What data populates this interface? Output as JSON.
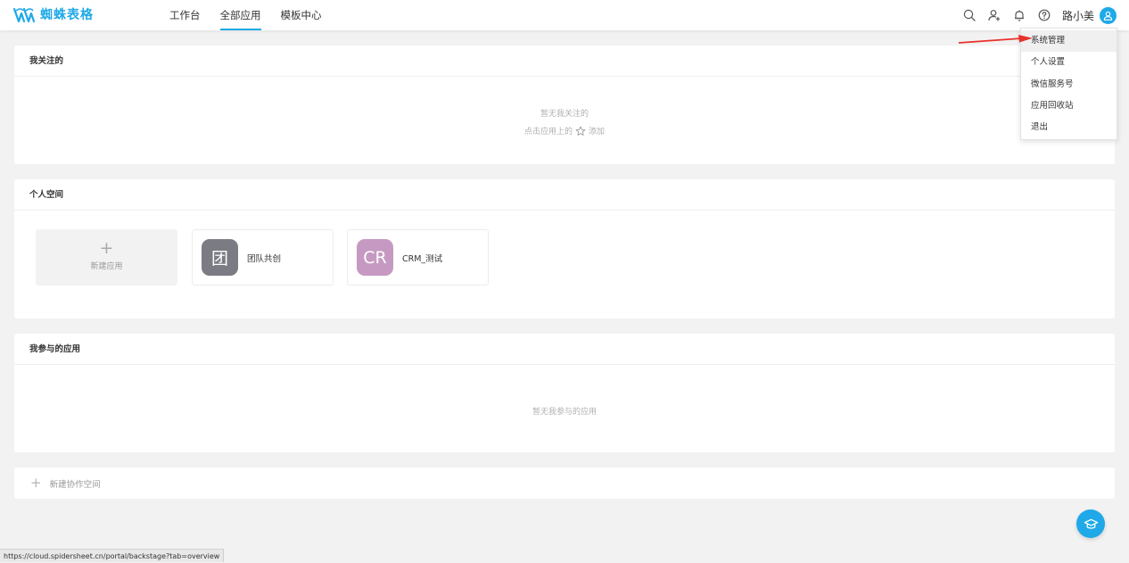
{
  "header": {
    "logo_text": "蜘蛛表格",
    "nav": [
      {
        "label": "工作台",
        "active": false
      },
      {
        "label": "全部应用",
        "active": true
      },
      {
        "label": "模板中心",
        "active": false
      }
    ],
    "user_name": "路小美",
    "icons": [
      "search-icon",
      "add-user-icon",
      "bell-icon",
      "help-icon",
      "user-avatar-icon"
    ]
  },
  "following": {
    "title": "我关注的",
    "empty_text": "暂无我关注的",
    "hint_before": "点击应用上的",
    "hint_after": "添加"
  },
  "personal": {
    "title": "个人空间",
    "new_app_label": "新建应用",
    "apps": [
      {
        "icon_text": "团",
        "name": "团队共创",
        "color": "#7b7b84"
      },
      {
        "icon_text": "CR",
        "name": "CRM_测试",
        "color": "#c699c2"
      }
    ]
  },
  "joined": {
    "title": "我参与的应用",
    "empty_text": "暂无我参与的应用"
  },
  "new_space": {
    "label": "新建协作空间"
  },
  "dropdown": {
    "items": [
      "系统管理",
      "个人设置",
      "微信服务号",
      "应用回收站",
      "退出"
    ]
  },
  "status_url": "https://cloud.spidersheet.cn/portal/backstage?tab=overview",
  "colors": {
    "accent": "#1fa9e8",
    "annotation_arrow": "#e8312a"
  }
}
